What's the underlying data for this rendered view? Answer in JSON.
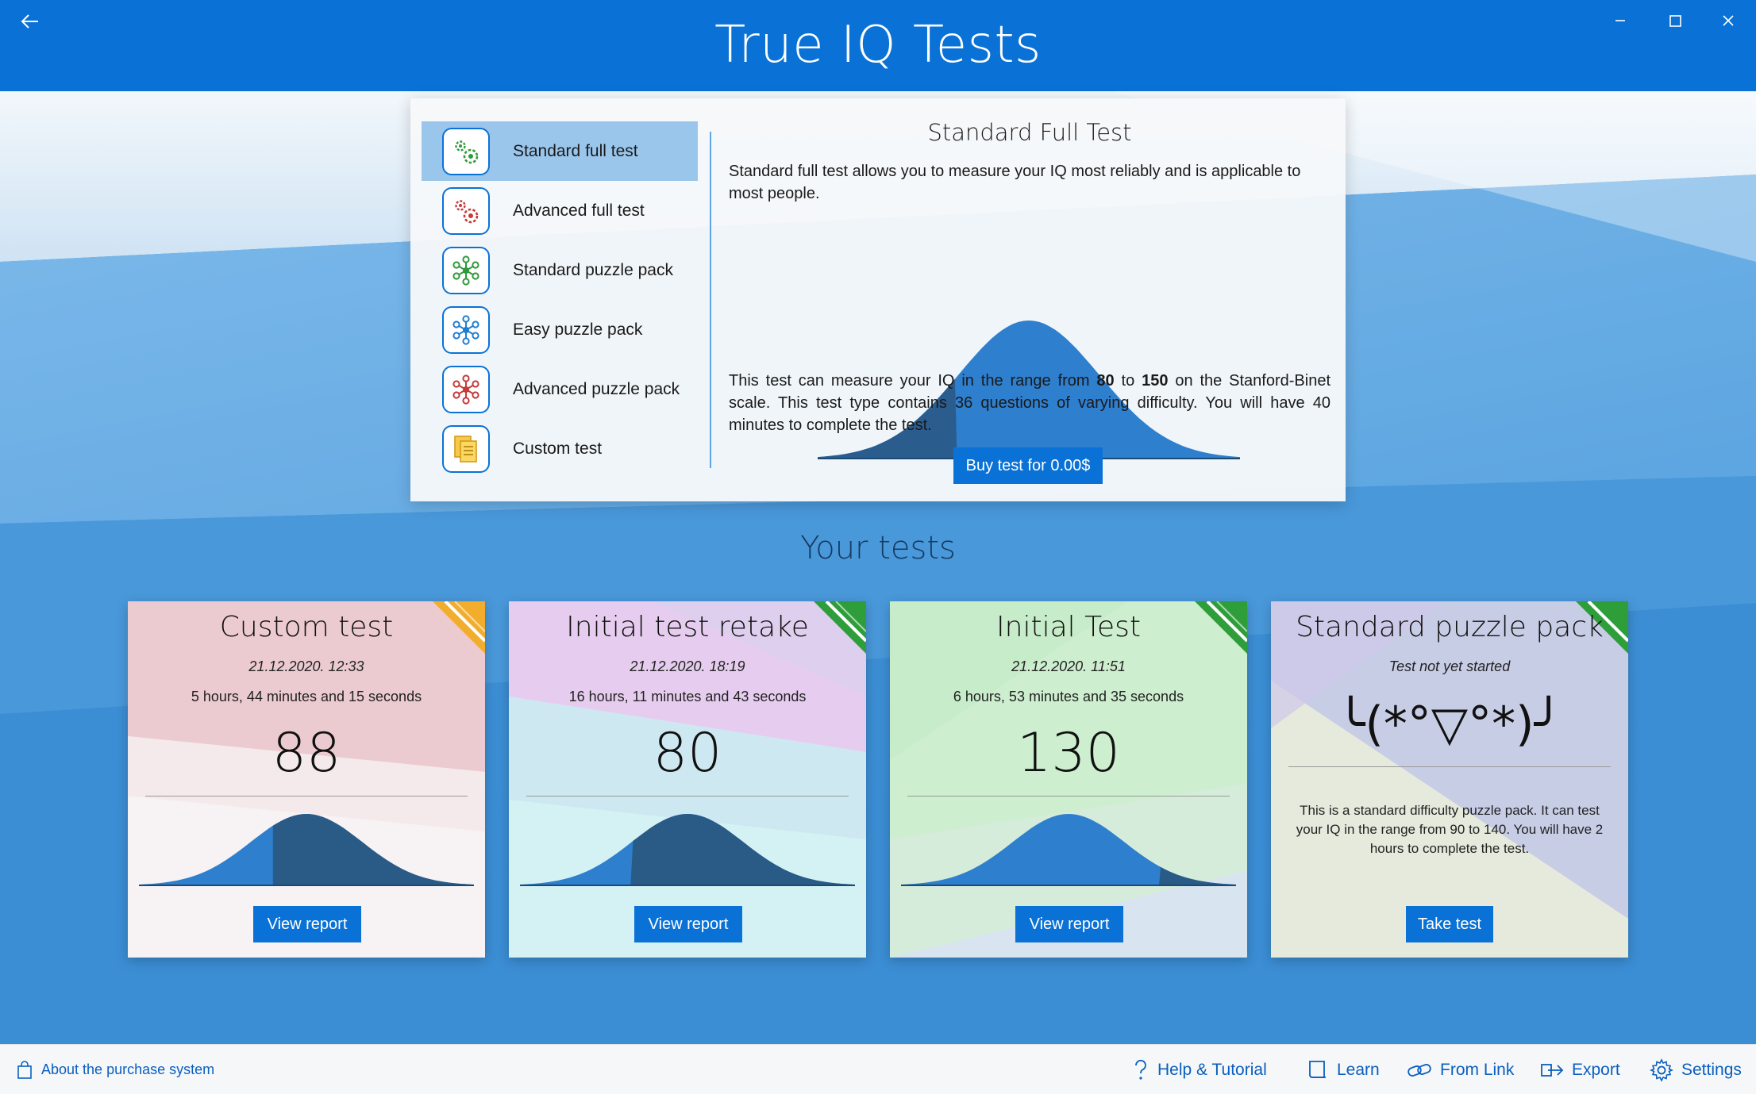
{
  "window": {
    "title": "True IQ Tests"
  },
  "test_types": [
    {
      "label": "Standard full test",
      "icon": "green-gears-icon",
      "selected": true
    },
    {
      "label": "Advanced full test",
      "icon": "red-gears-icon",
      "selected": false
    },
    {
      "label": "Standard puzzle pack",
      "icon": "green-network-icon",
      "selected": false
    },
    {
      "label": "Easy puzzle pack",
      "icon": "blue-network-icon",
      "selected": false
    },
    {
      "label": "Advanced puzzle pack",
      "icon": "red-network-icon",
      "selected": false
    },
    {
      "label": "Custom test",
      "icon": "documents-icon",
      "selected": false
    }
  ],
  "detail": {
    "title": "Standard Full Test",
    "description": "Standard full test allows you to measure your IQ most reliably and is applicable to most people.",
    "range_prefix": "This test can measure your IQ in the range from ",
    "range_min": "80",
    "range_to": " to ",
    "range_max": "150",
    "range_suffix": " on the Stanford-Binet scale. This test type contains 36 questions of varying difficulty. You will have 40 minutes to complete the test.",
    "buy_label": "Buy test for 0.00$",
    "bell_highlight_fraction": 0.33
  },
  "your_tests": {
    "heading": "Your tests",
    "cards": [
      {
        "title": "Custom test",
        "date": "21.12.2020. 12:33",
        "duration": "5 hours, 44 minutes and 15 seconds",
        "score": "88",
        "button": "View report",
        "corner_color": "#f3ad2c",
        "score_fraction": 0.4
      },
      {
        "title": "Initial test retake",
        "date": "21.12.2020. 18:19",
        "duration": "16 hours, 11 minutes and 43 seconds",
        "score": "80",
        "button": "View report",
        "corner_color": "#2e9e3a",
        "score_fraction": 0.33
      },
      {
        "title": "Initial Test",
        "date": "21.12.2020. 11:51",
        "duration": "6 hours, 53 minutes and 35 seconds",
        "score": "130",
        "button": "View report",
        "corner_color": "#2e9e3a",
        "score_fraction": 0.77
      },
      {
        "title": "Standard puzzle pack",
        "date": "Test not yet started",
        "kaomoji": "╰(*°▽°*)╯",
        "description": "This is a standard difficulty puzzle pack. It can test your IQ in the range from 90 to 140. You will have 2 hours to complete the test.",
        "button": "Take test",
        "corner_color": "#2e9e3a"
      }
    ]
  },
  "bottom_bar": {
    "purchase": "About the purchase system",
    "help": "Help & Tutorial",
    "learn": "Learn",
    "from_link": "From Link",
    "export": "Export",
    "settings": "Settings"
  },
  "colors": {
    "accent": "#0a72d6",
    "selected_item": "#9ac6ec",
    "bell_fill": "#2e7fce",
    "bell_dark": "#1e4f7c"
  }
}
